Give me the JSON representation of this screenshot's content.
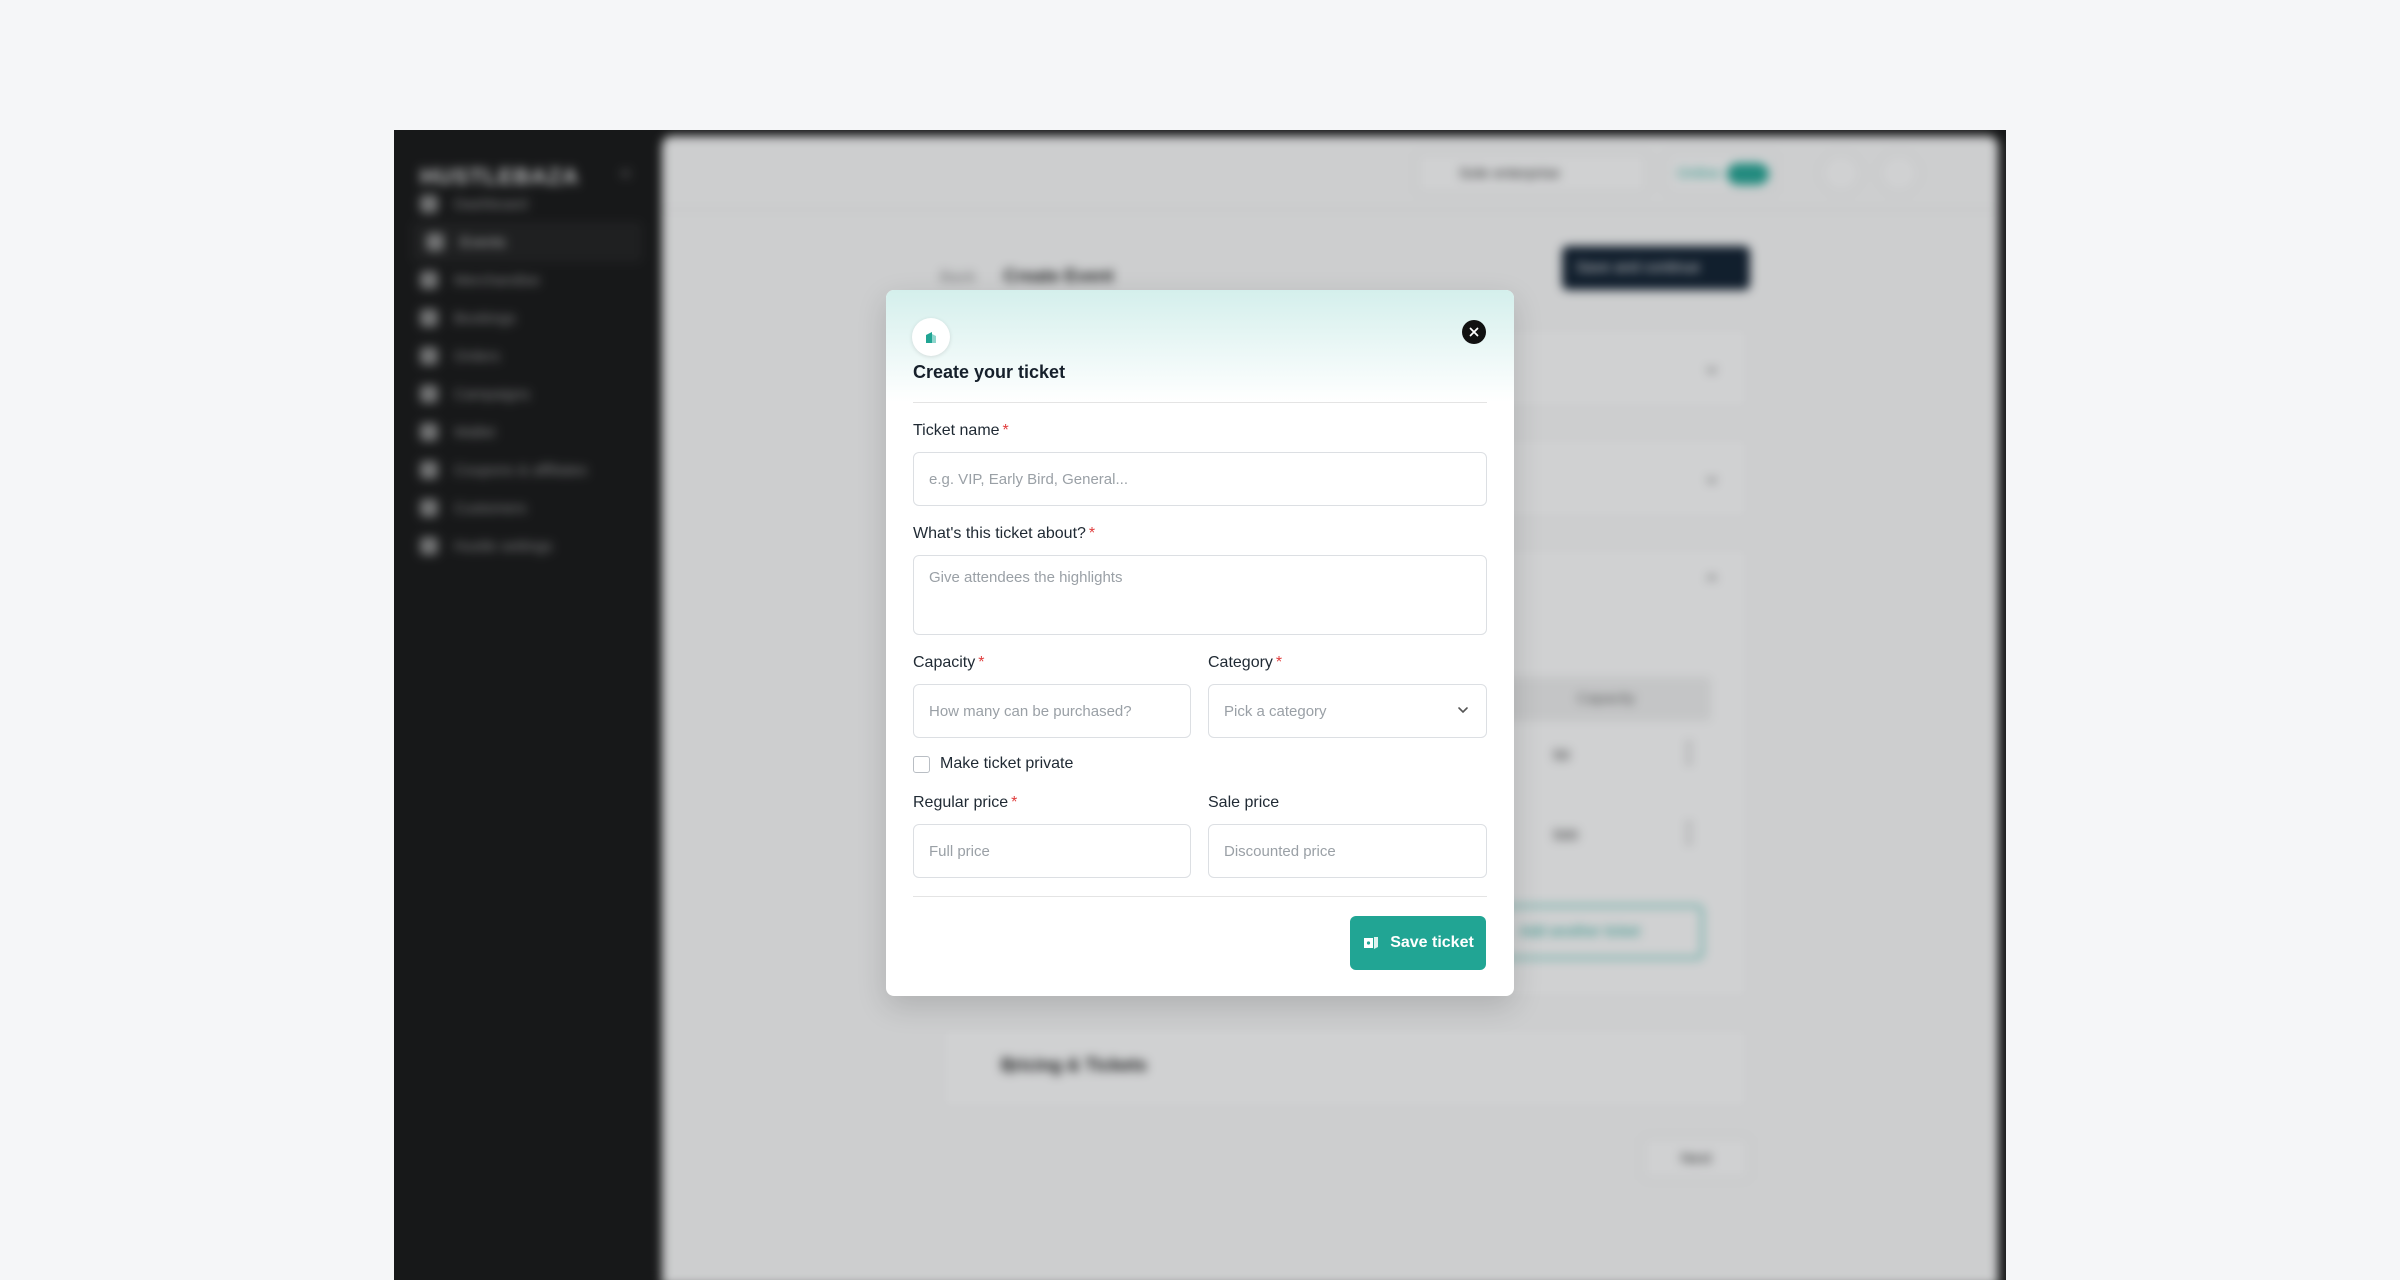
{
  "app": {
    "logo_text": "HUSTLEBAZA",
    "sidebar": {
      "items": [
        {
          "label": "Dashboard",
          "icon": "dashboard-icon"
        },
        {
          "label": "Events",
          "icon": "events-icon",
          "active": true
        },
        {
          "label": "Merchandise",
          "icon": "merchandise-icon"
        },
        {
          "label": "Bookings",
          "icon": "bookings-icon"
        },
        {
          "label": "Orders",
          "icon": "orders-icon"
        },
        {
          "label": "Campaigns",
          "icon": "campaigns-icon"
        },
        {
          "label": "Wallet",
          "icon": "wallet-icon"
        },
        {
          "label": "Coupons & affiliates",
          "icon": "coupons-icon"
        },
        {
          "label": "Customers",
          "icon": "customers-icon"
        },
        {
          "label": "Hustle settings",
          "icon": "settings-icon"
        }
      ]
    },
    "topbar": {
      "workspace": "Sole enterprise",
      "online_label": "Online"
    },
    "breadcrumb": {
      "back": "Back",
      "title": "Create Event"
    },
    "save_continue": "Save and continue",
    "tickets_table": {
      "capacity_header": "Capacity",
      "rows": [
        {
          "capacity": "50"
        },
        {
          "capacity": "500"
        }
      ]
    },
    "add_another_ticket": "Add another ticket",
    "pricing_section": "Pricing & Tickets",
    "next_button": "Next"
  },
  "modal": {
    "title": "Create your ticket",
    "ticket_name": {
      "label": "Ticket name",
      "placeholder": "e.g. VIP, Early Bird, General..."
    },
    "about": {
      "label": "What's this ticket about?",
      "placeholder": "Give attendees the highlights"
    },
    "capacity": {
      "label": "Capacity",
      "placeholder": "How many can be purchased?"
    },
    "category": {
      "label": "Category",
      "placeholder": "Pick a category"
    },
    "private": {
      "label": "Make ticket private",
      "checked": false
    },
    "regular_price": {
      "label": "Regular price",
      "placeholder": "Full price"
    },
    "sale_price": {
      "label": "Sale price",
      "placeholder": "Discounted price"
    },
    "save_button": "Save ticket",
    "required_mark": "*"
  },
  "colors": {
    "accent": "#21a594",
    "required": "#e03b3b",
    "title": "#16202b"
  }
}
